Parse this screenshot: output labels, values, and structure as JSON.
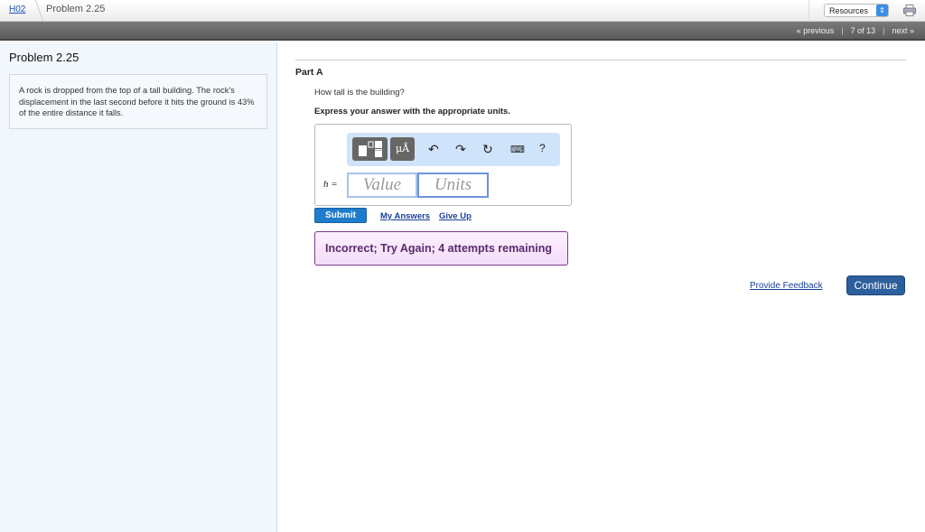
{
  "breadcrumb": {
    "parent": "H02",
    "current": "Problem 2.25"
  },
  "header": {
    "resources_label": "Resources",
    "print_icon": "printer-icon"
  },
  "nav": {
    "previous": "« previous",
    "position": "7 of 13",
    "next": "next »",
    "separator": "|"
  },
  "problem": {
    "title": "Problem 2.25",
    "text": "A rock is dropped from the top of a tall building. The rock's displacement in the last second before it hits the ground is 43% of the entire distance it falls."
  },
  "part": {
    "label": "Part A",
    "question": "How tall is the building?",
    "instruction": "Express your answer with the appropriate units."
  },
  "toolbar": {
    "units_label": "μÅ",
    "help": "?"
  },
  "answer": {
    "variable": "h =",
    "value_placeholder": "Value",
    "units_placeholder": "Units"
  },
  "actions": {
    "submit": "Submit",
    "my_answers": "My Answers",
    "give_up": "Give Up"
  },
  "feedback": {
    "message": "Incorrect; Try Again; 4 attempts remaining"
  },
  "footer": {
    "provide_feedback": "Provide Feedback",
    "continue": "Continue"
  }
}
